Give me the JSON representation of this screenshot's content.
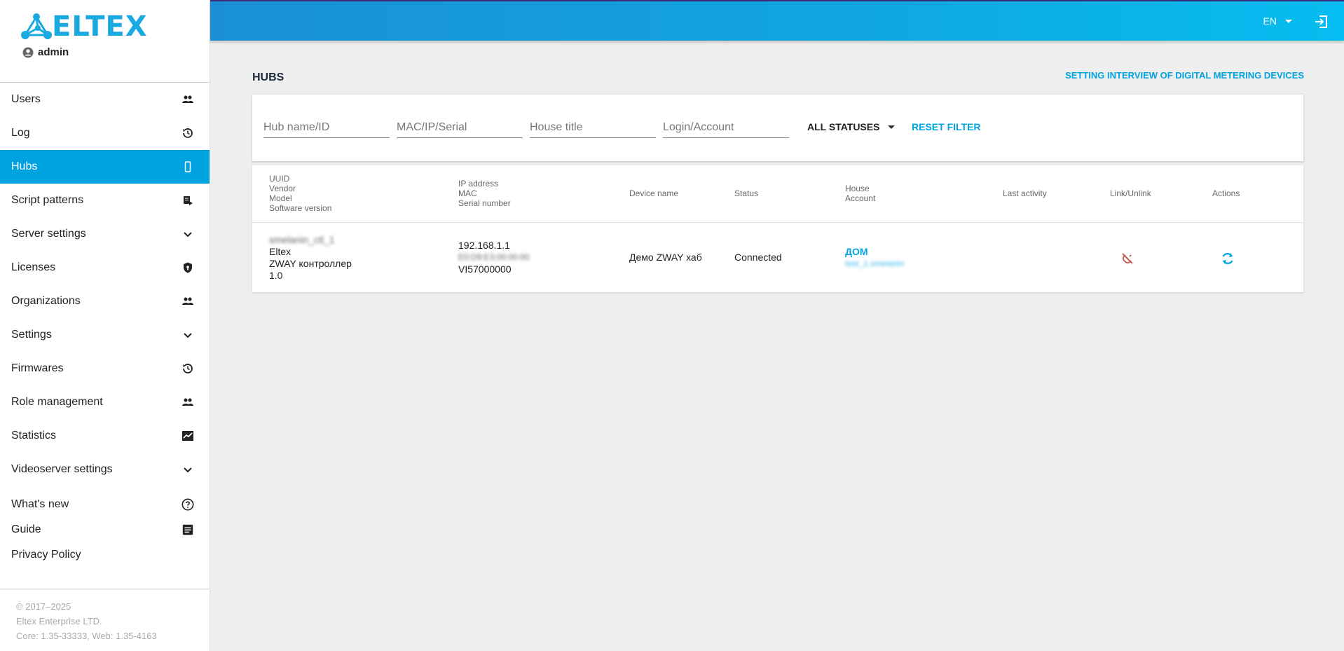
{
  "app": {
    "logo_text": "ELTEX",
    "user_name": "admin",
    "brand_color": "#1aa9e0",
    "accent_color": "#00a3e0"
  },
  "sidebar": {
    "items": [
      {
        "label": "Users",
        "icon": "people-icon",
        "active": false
      },
      {
        "label": "Log",
        "icon": "history-icon",
        "active": false
      },
      {
        "label": "Hubs",
        "icon": "phone-icon",
        "active": true
      },
      {
        "label": "Script patterns",
        "icon": "script-icon",
        "active": false
      },
      {
        "label": "Server settings",
        "icon": "chevron-down-icon",
        "active": false
      },
      {
        "label": "Licenses",
        "icon": "shield-icon",
        "active": false
      },
      {
        "label": "Organizations",
        "icon": "people-icon",
        "active": false
      },
      {
        "label": "Settings",
        "icon": "chevron-down-icon",
        "active": false
      },
      {
        "label": "Firmwares",
        "icon": "history-icon",
        "active": false
      },
      {
        "label": "Role management",
        "icon": "people-icon",
        "active": false
      },
      {
        "label": "Statistics",
        "icon": "chart-icon",
        "active": false
      },
      {
        "label": "Videoserver settings",
        "icon": "chevron-down-icon",
        "active": false
      }
    ],
    "secondary": [
      {
        "label": "What's new",
        "icon": "help-circle-icon"
      },
      {
        "label": "Guide",
        "icon": "document-icon"
      },
      {
        "label": "Privacy Policy",
        "icon": ""
      }
    ],
    "footer": {
      "copyright": "© 2017–2025",
      "company": "Eltex Enterprise LTD.",
      "version": "Core: 1.35-33333, Web: 1.35-4163"
    }
  },
  "header": {
    "language": "EN",
    "logout_icon": "logout-icon"
  },
  "main": {
    "title": "HUBS",
    "top_link": "SETTING INTERVIEW OF DIGITAL METERING DEVICES",
    "filters": {
      "hub_placeholder": "Hub name/ID",
      "mac_placeholder": "MAC/IP/Serial",
      "house_placeholder": "House title",
      "login_placeholder": "Login/Account",
      "status_value": "ALL STATUSES",
      "reset_label": "RESET FILTER"
    },
    "table": {
      "headers": {
        "col1": [
          "UUID",
          "Vendor",
          "Model",
          "Software version"
        ],
        "col2": [
          "IP address",
          "MAC",
          "Serial number"
        ],
        "device_name": "Device name",
        "status": "Status",
        "col5": [
          "House",
          "Account"
        ],
        "last_activity": "Last activity",
        "link_unlink": "Link/Unlink",
        "actions": "Actions"
      },
      "rows": [
        {
          "uuid": "smelanin_ctl_1",
          "vendor": "Eltex",
          "model": "ZWAY контроллер",
          "software_version": "1.0",
          "ip": "192.168.1.1",
          "mac": "E0:D9:E3:00:00:00",
          "serial": "VI57000000",
          "device_name": "Демо ZWAY хаб",
          "status": "Connected",
          "house": "ДОМ",
          "account": "test_1.smelanin",
          "last_activity": "",
          "link_icon": "unlink-icon",
          "action_icon": "sync-icon"
        }
      ]
    }
  }
}
